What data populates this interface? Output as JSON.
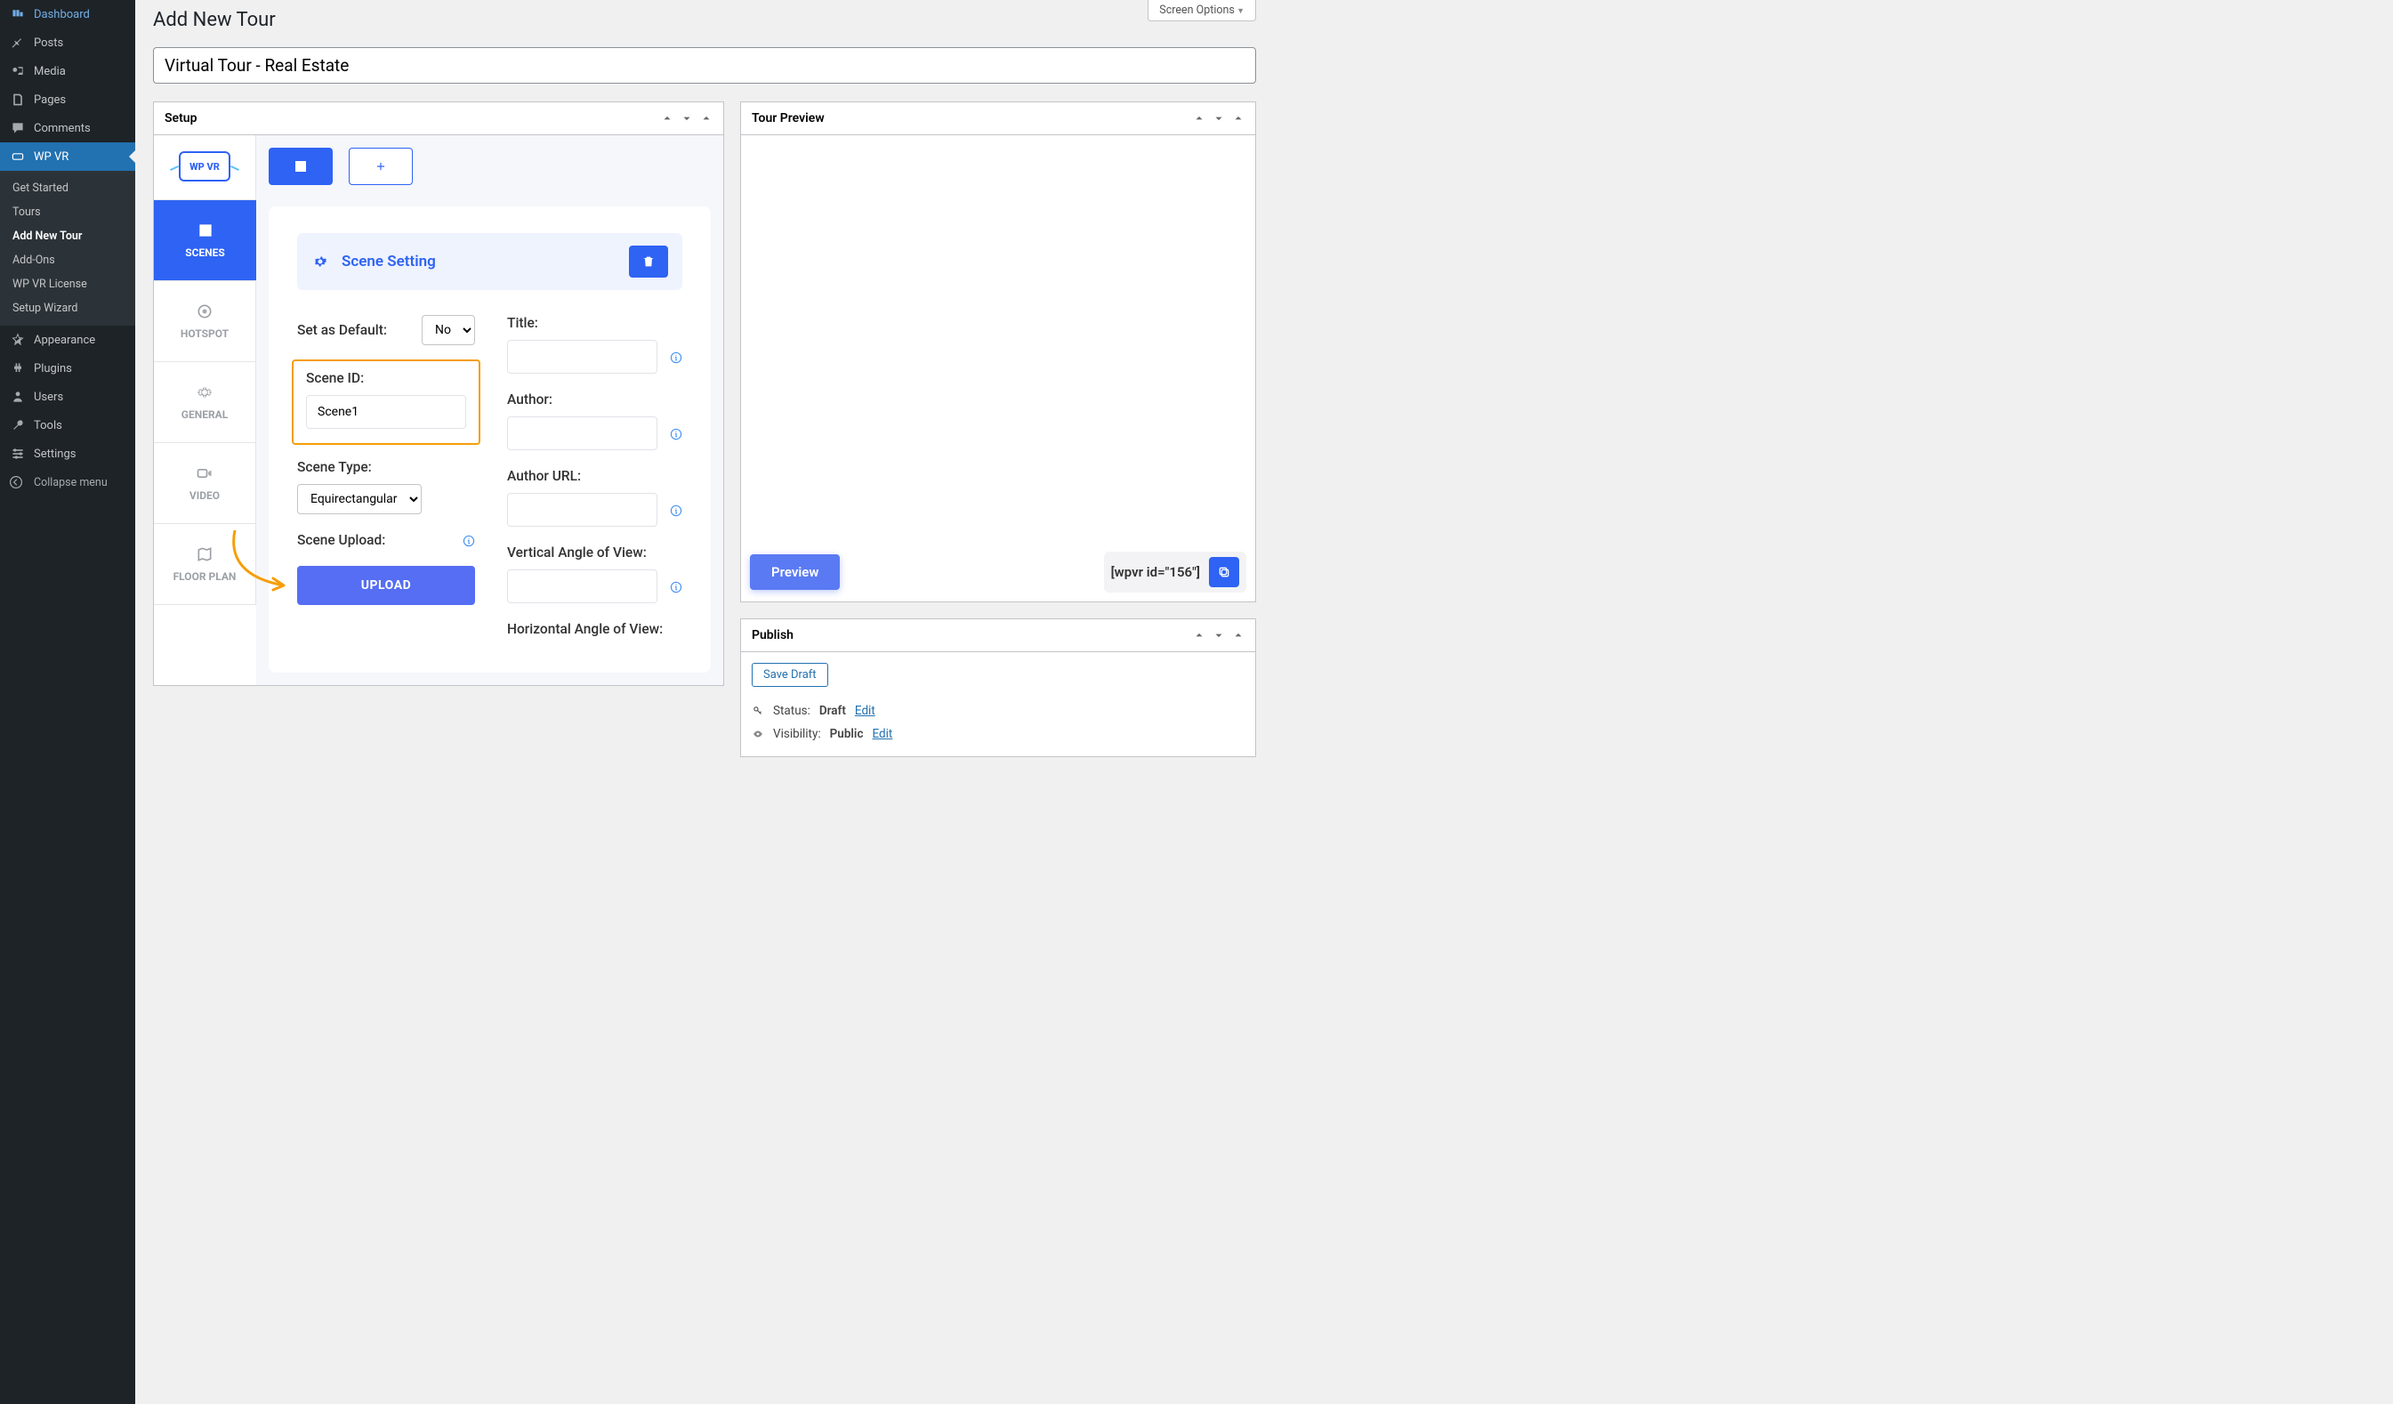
{
  "sidebar": {
    "items": [
      {
        "icon": "dashboard",
        "label": "Dashboard"
      },
      {
        "icon": "pin",
        "label": "Posts"
      },
      {
        "icon": "media",
        "label": "Media"
      },
      {
        "icon": "page",
        "label": "Pages"
      },
      {
        "icon": "comment",
        "label": "Comments"
      },
      {
        "icon": "wpvr",
        "label": "WP VR"
      },
      {
        "icon": "appearance",
        "label": "Appearance"
      },
      {
        "icon": "plugin",
        "label": "Plugins"
      },
      {
        "icon": "user",
        "label": "Users"
      },
      {
        "icon": "tool",
        "label": "Tools"
      },
      {
        "icon": "settings",
        "label": "Settings"
      }
    ],
    "wpvr_sub": [
      "Get Started",
      "Tours",
      "Add New Tour",
      "Add-Ons",
      "WP VR License",
      "Setup Wizard"
    ],
    "collapse": "Collapse menu"
  },
  "header": {
    "screen_options": "Screen Options",
    "page_title": "Add New Tour",
    "title_value": "Virtual Tour - Real Estate"
  },
  "setup": {
    "box_title": "Setup",
    "tabs": [
      "SCENES",
      "HOTSPOT",
      "GENERAL",
      "VIDEO",
      "FLOOR PLAN"
    ],
    "logo_text": "WP VR",
    "scene_setting": "Scene Setting",
    "set_default": "Set as Default:",
    "set_default_val": "No",
    "scene_id_label": "Scene ID:",
    "scene_id_val": "Scene1",
    "scene_type_label": "Scene Type:",
    "scene_type_val": "Equirectangular",
    "scene_upload_label": "Scene Upload:",
    "upload_btn": "UPLOAD",
    "title_label": "Title:",
    "author_label": "Author:",
    "author_url_label": "Author URL:",
    "vangle_label": "Vertical Angle of View:",
    "hangle_label": "Horizontal Angle of View:"
  },
  "preview": {
    "box_title": "Tour Preview",
    "preview_btn": "Preview",
    "shortcode": "[wpvr id=\"156\"]"
  },
  "publish": {
    "box_title": "Publish",
    "save_draft": "Save Draft",
    "status_label": "Status:",
    "status_val": "Draft",
    "visibility_label": "Visibility:",
    "visibility_val": "Public",
    "edit": "Edit"
  }
}
